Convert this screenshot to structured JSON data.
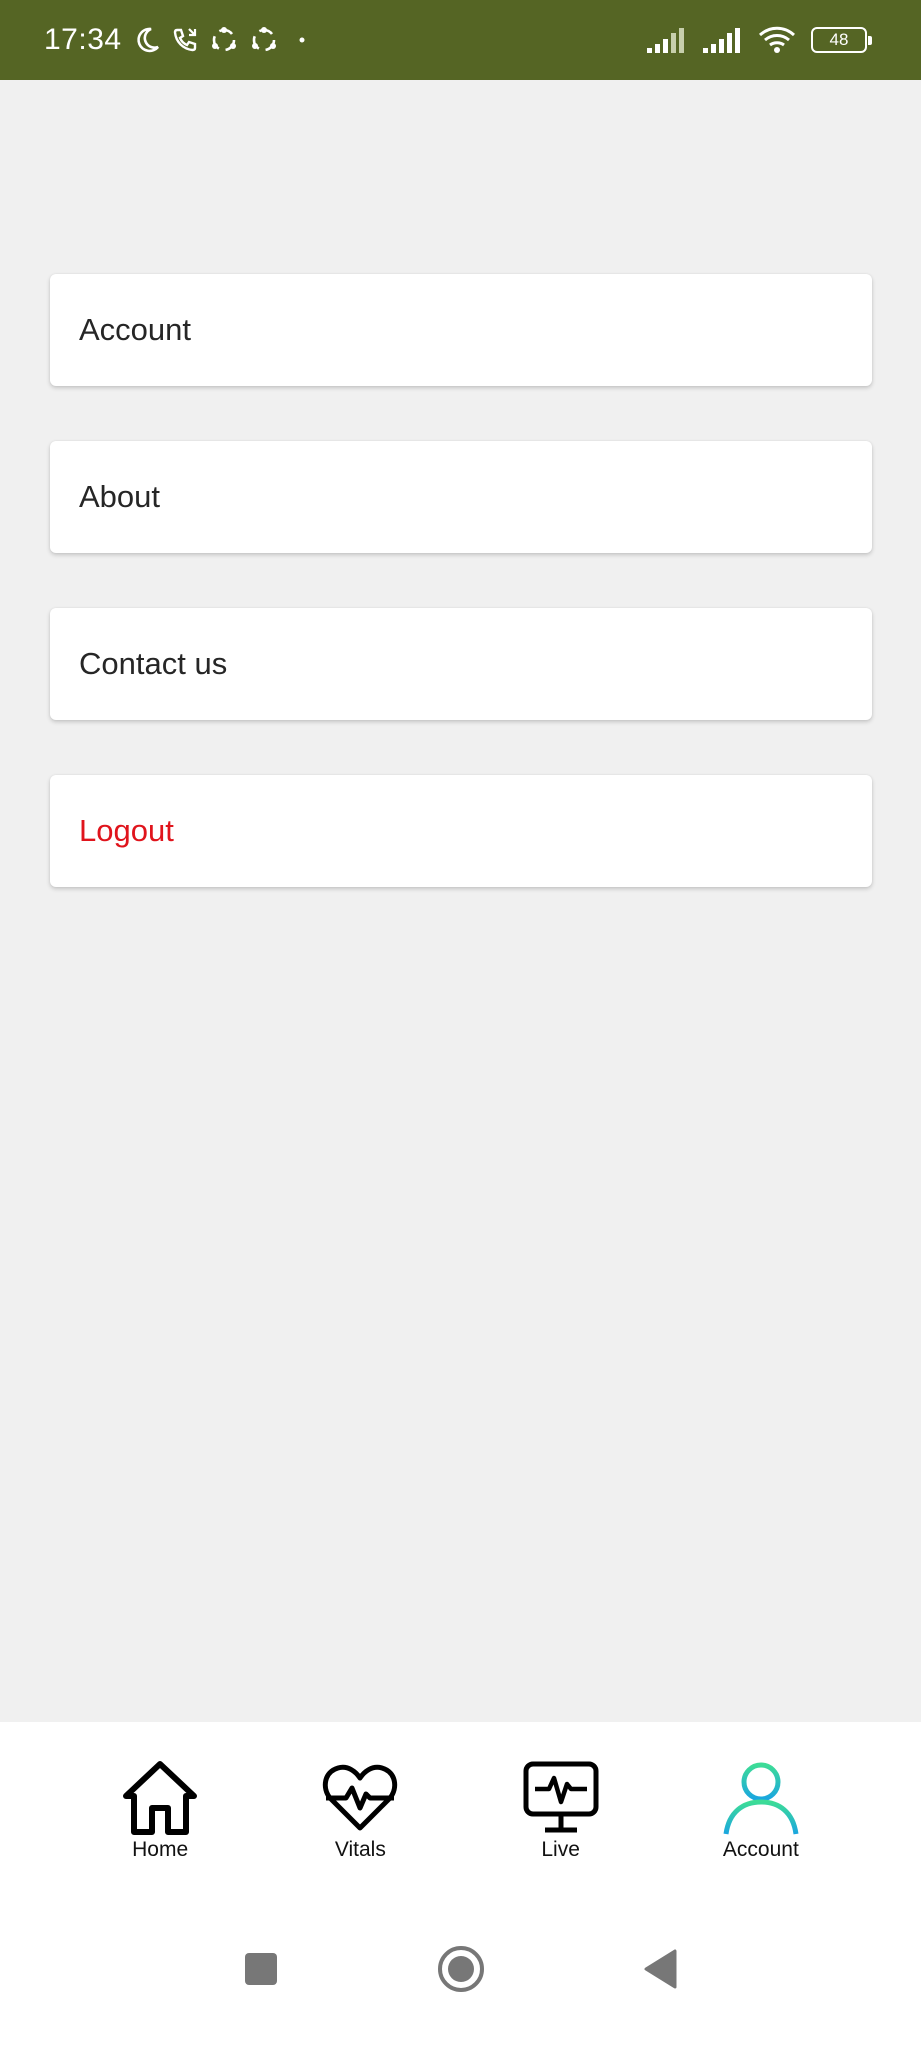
{
  "status_bar": {
    "time": "17:34",
    "battery": "48",
    "icons": [
      "moon-icon",
      "call-icon",
      "sync-icon",
      "sync-icon",
      "dot-icon",
      "signal-icon",
      "signal-icon",
      "wifi-icon",
      "battery-icon"
    ]
  },
  "menu": {
    "items": [
      {
        "label": "Account"
      },
      {
        "label": "About"
      },
      {
        "label": "Contact us"
      },
      {
        "label": "Logout",
        "color": "#e0141c"
      }
    ]
  },
  "tab_bar": {
    "active": "Account",
    "accent_colors": [
      "#3ddc97",
      "#1aa6e0"
    ],
    "tabs": [
      {
        "label": "Home",
        "icon": "home-icon"
      },
      {
        "label": "Vitals",
        "icon": "heart-pulse-icon"
      },
      {
        "label": "Live",
        "icon": "monitor-pulse-icon"
      },
      {
        "label": "Account",
        "icon": "user-icon"
      }
    ]
  },
  "system_nav": {
    "buttons": [
      "recents-icon",
      "home-circle-icon",
      "back-icon"
    ]
  },
  "colors": {
    "status_bar": "#556524",
    "background": "#f0f0f0",
    "logout": "#e0141c"
  }
}
